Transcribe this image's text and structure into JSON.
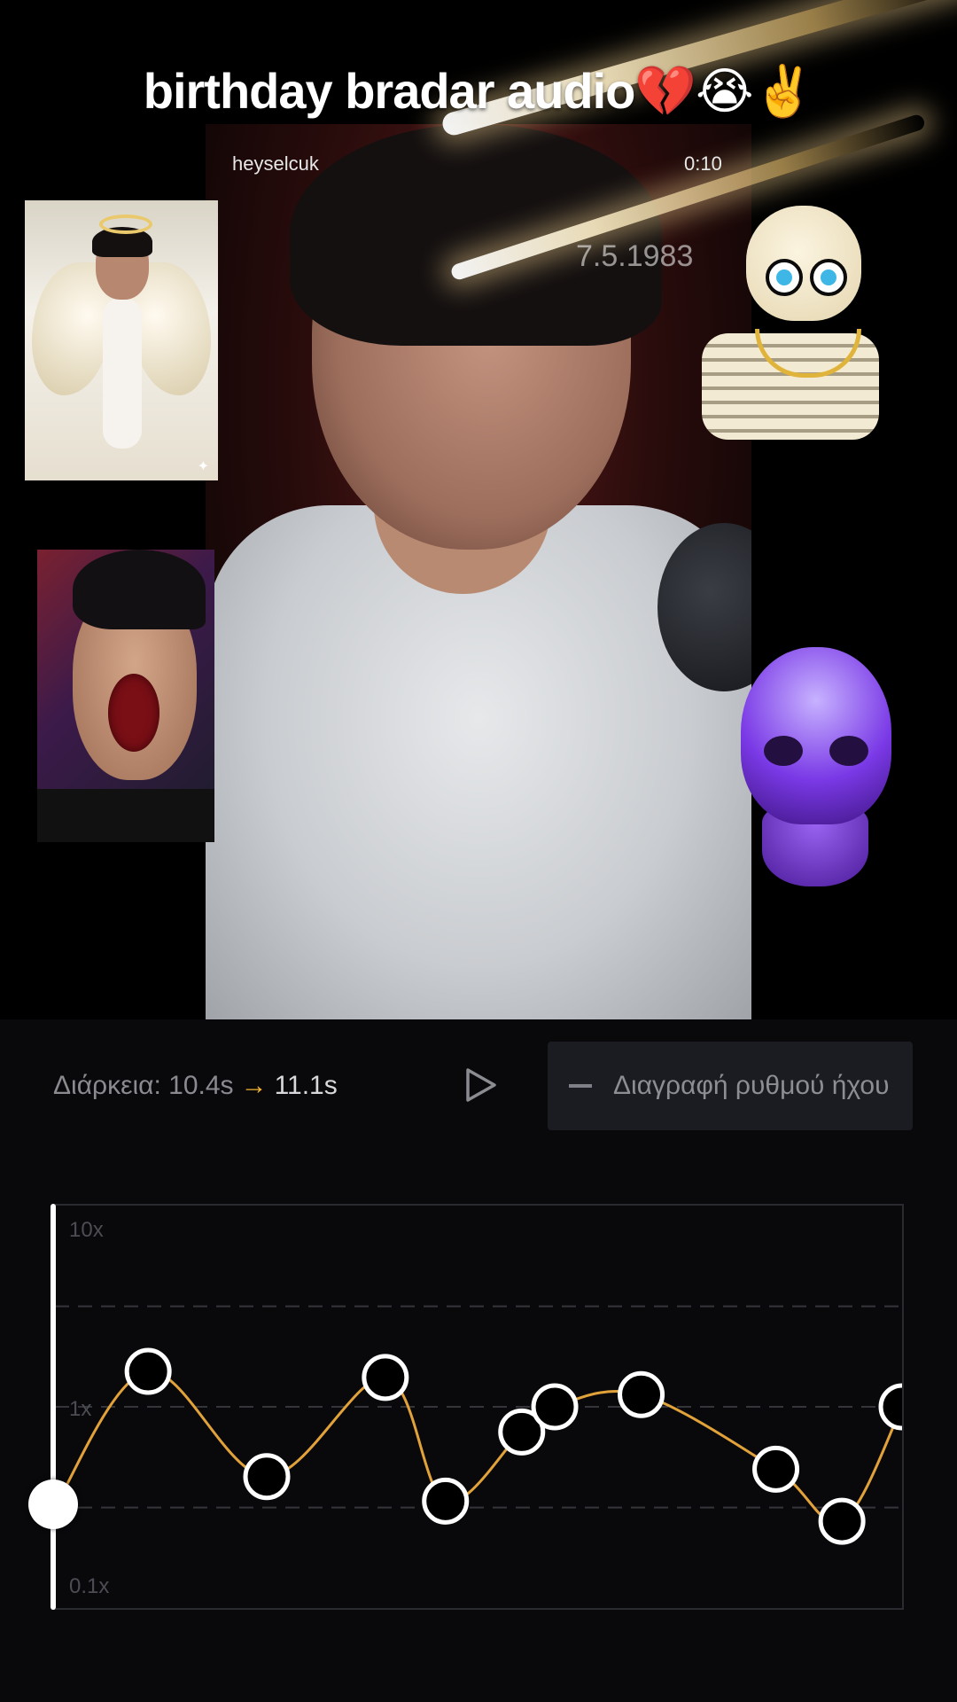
{
  "caption": {
    "title": "birthday bradar audio💔😭✌️"
  },
  "video": {
    "username": "heyselcuk",
    "timestamp": "0:10",
    "watermark_date": "7.5.1983"
  },
  "stickers": {
    "angel": "angel-sticker",
    "scream": "screaming-face-sticker",
    "skeleton": "skeleton-sticker",
    "purple_skull": "purple-skull-sticker",
    "sparkle_icon": "✦"
  },
  "editor": {
    "duration_label": "Διάρκεια: 10.4s",
    "duration_arrow": "→",
    "duration_new": "11.1s",
    "play_icon": "play-icon",
    "delete_label": "Διαγραφή ρυθμού ήχου"
  },
  "chart_data": {
    "type": "line",
    "y_scale": "log",
    "ylim": [
      0.1,
      10
    ],
    "ytick_labels": [
      "10x",
      "1x",
      "0.1x"
    ],
    "gridlines": [
      3.16,
      1,
      0.316
    ],
    "line_color": "#e2a23a",
    "playhead_point": {
      "t": 0.0,
      "speed": 0.32
    },
    "points": [
      {
        "t": 0.11,
        "speed": 1.5
      },
      {
        "t": 0.25,
        "speed": 0.45
      },
      {
        "t": 0.39,
        "speed": 1.4
      },
      {
        "t": 0.461,
        "speed": 0.34
      },
      {
        "t": 0.551,
        "speed": 0.75
      },
      {
        "t": 0.59,
        "speed": 1.0
      },
      {
        "t": 0.692,
        "speed": 1.15
      },
      {
        "t": 0.851,
        "speed": 0.49
      },
      {
        "t": 0.929,
        "speed": 0.27
      },
      {
        "t": 1.0,
        "speed": 1.0
      }
    ]
  }
}
